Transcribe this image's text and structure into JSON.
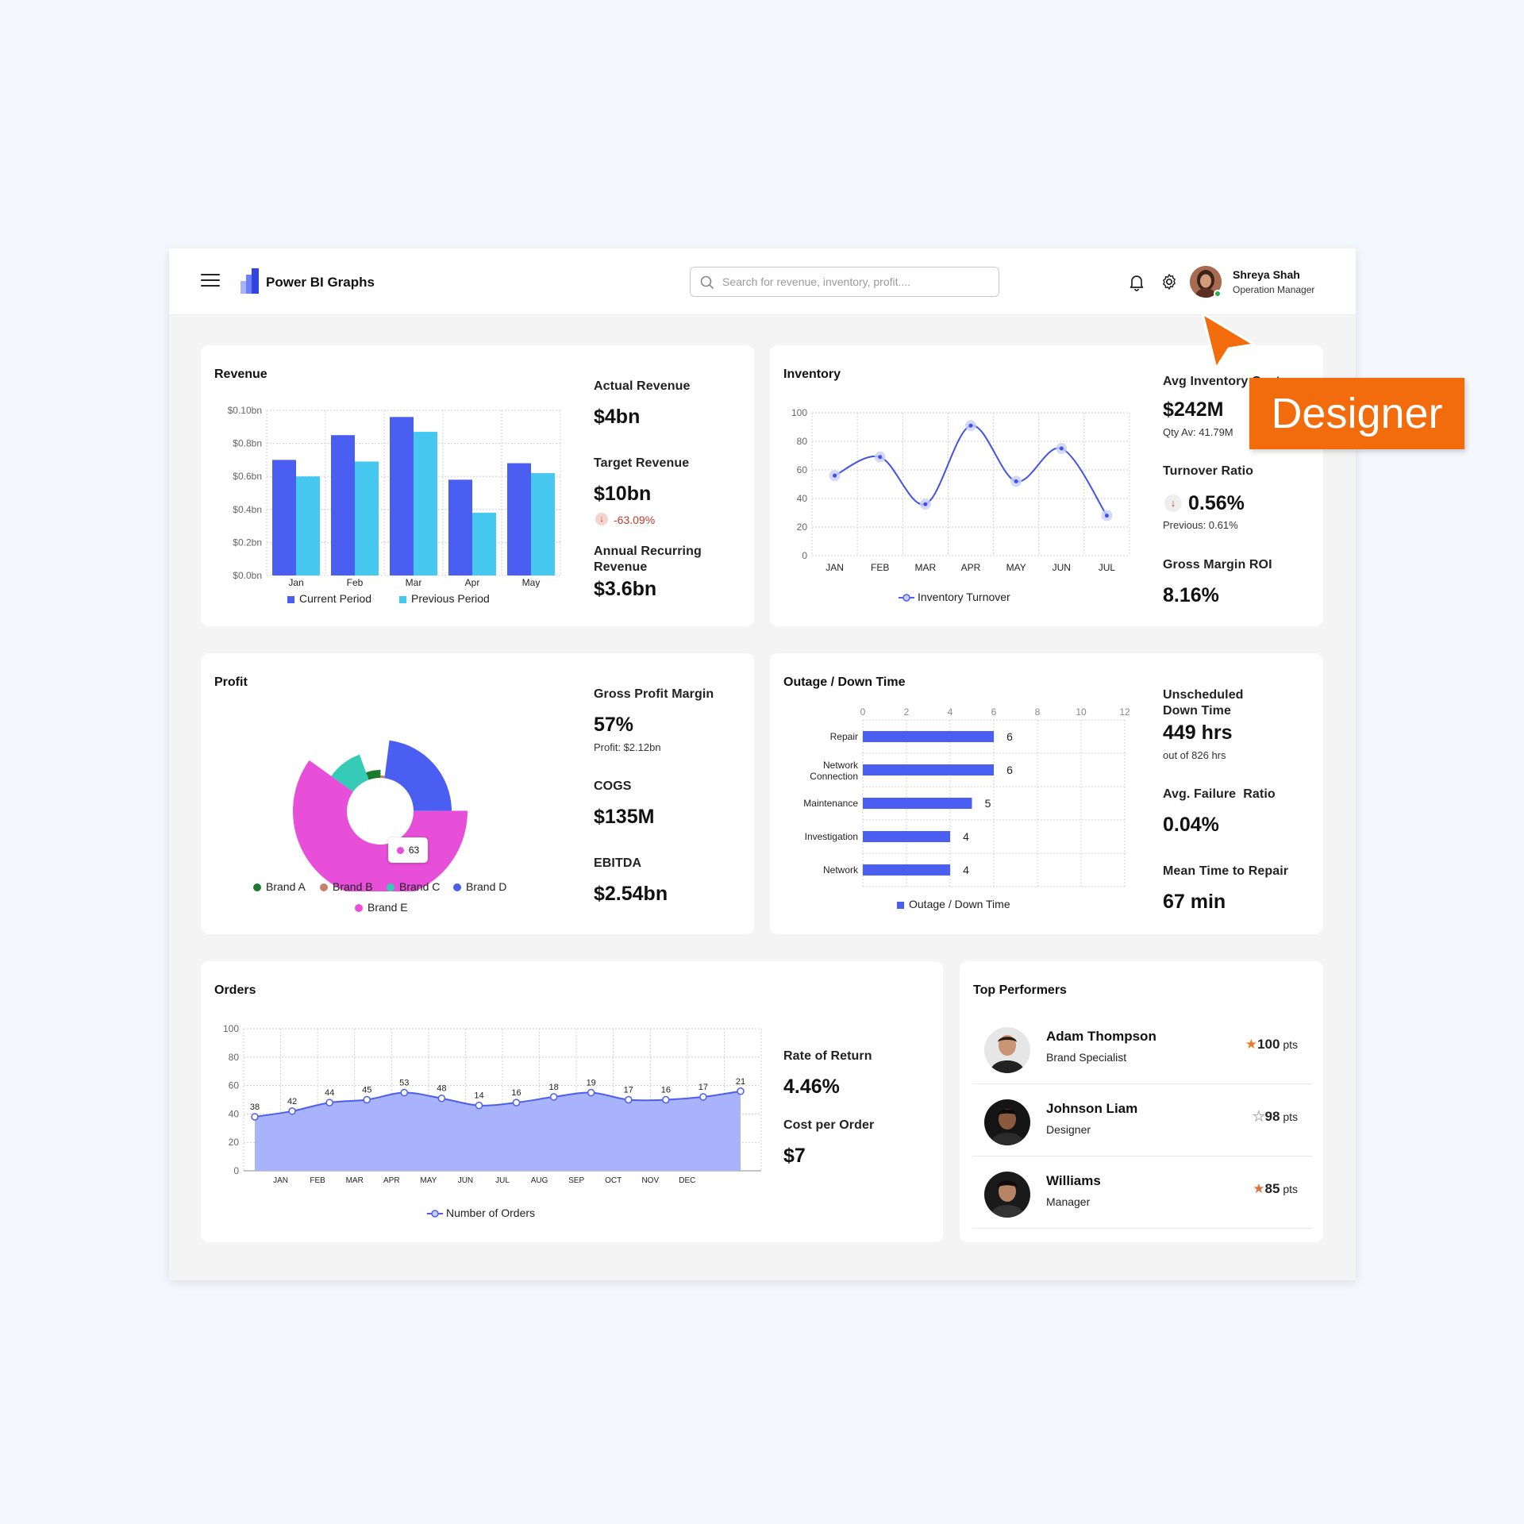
{
  "app": {
    "title": "Power BI Graphs"
  },
  "search": {
    "placeholder": "Search for revenue, inventory, profit...."
  },
  "user": {
    "name": "Shreya Shah",
    "role": "Operation Manager"
  },
  "overlay": {
    "tag": "Designer"
  },
  "colors": {
    "accent": "#4a5ef2",
    "light_blue": "#46c8f0",
    "orange": "#f26c0d",
    "negative": "#c0392b",
    "area_fill": "#a9b3fb"
  },
  "revenue": {
    "title": "Revenue",
    "actual_label": "Actual Revenue",
    "actual_value": "$4bn",
    "target_label": "Target Revenue",
    "target_value": "$10bn",
    "target_change": "-63.09%",
    "arr_label": "Annual  Recurring Revenue",
    "arr_value": "$3.6bn"
  },
  "inventory": {
    "title": "Inventory",
    "avg_cost_label": "Avg Inventory Cost",
    "avg_cost_value": "$242M",
    "qty_avg": "Qty Av: 41.79M",
    "turnover_label": "Turnover Ratio",
    "turnover_value": "0.56%",
    "turnover_prev": "Previous: 0.61%",
    "gmroi_label": "Gross Margin ROI",
    "gmroi_value": "8.16%"
  },
  "profit": {
    "title": "Profit",
    "gpm_label": "Gross Profit Margin",
    "gpm_value": "57%",
    "gpm_sub": "Profit: $2.12bn",
    "cogs_label": "COGS",
    "cogs_value": "$135M",
    "ebitda_label": "EBITDA",
    "ebitda_value": "$2.54bn"
  },
  "outage": {
    "title": "Outage / Down Time",
    "unsched_label": "Unscheduled Down Time",
    "unsched_value": "449 hrs",
    "unsched_sub": "out of 826 hrs",
    "afr_label": "Avg. Failure  Ratio",
    "afr_value": "0.04%",
    "mttr_label": "Mean Time to Repair",
    "mttr_value": "67 min"
  },
  "orders": {
    "title": "Orders",
    "ror_label": "Rate of Return",
    "ror_value": "4.46%",
    "cpo_label": "Cost per Order",
    "cpo_value": "$7"
  },
  "performers": {
    "title": "Top Performers",
    "items": [
      {
        "name": "Adam Thompson",
        "role": "Brand Specialist",
        "points": "100",
        "unit": "pts",
        "star": "#f07a2a"
      },
      {
        "name": "Johnson Liam",
        "role": "Designer",
        "points": "98",
        "unit": "pts",
        "star": "#ffffff"
      },
      {
        "name": "Williams",
        "role": "Manager",
        "points": "85",
        "unit": "pts",
        "star": "#e07040"
      }
    ]
  },
  "chart_data": [
    {
      "id": "revenue",
      "type": "bar",
      "categories": [
        "Jan",
        "Feb",
        "Mar",
        "Apr",
        "May"
      ],
      "y_ticks": [
        "$0.0bn",
        "$0.2bn",
        "$0.4bn",
        "$0.6bn",
        "$0.8bn",
        "$0.10bn"
      ],
      "ylim": [
        0,
        1.0
      ],
      "series": [
        {
          "name": "Current Period",
          "color": "#4a5ef2",
          "values": [
            0.7,
            0.85,
            0.96,
            0.58,
            0.68
          ]
        },
        {
          "name": "Previous Period",
          "color": "#46c8f0",
          "values": [
            0.6,
            0.69,
            0.87,
            0.38,
            0.62
          ]
        }
      ]
    },
    {
      "id": "inventory",
      "type": "line",
      "categories": [
        "JAN",
        "FEB",
        "MAR",
        "APR",
        "MAY",
        "JUN",
        "JUL"
      ],
      "ylim": [
        0,
        100
      ],
      "y_ticks": [
        0,
        20,
        40,
        60,
        80,
        100
      ],
      "series": [
        {
          "name": "Inventory Turnover",
          "color": "#3f51e8",
          "values": [
            56,
            69,
            36,
            91,
            52,
            75,
            28
          ]
        }
      ]
    },
    {
      "id": "profit",
      "type": "pie",
      "labels": [
        "Brand A",
        "Brand B",
        "Brand C",
        "Brand D",
        "Brand E"
      ],
      "colors": [
        "#1b7a2c",
        "#c8806a",
        "#36cbb6",
        "#4a5ef2",
        "#e84fd8"
      ],
      "values": [
        6,
        2,
        10,
        24,
        63
      ],
      "tooltip": {
        "label": "Brand E",
        "value": "63"
      }
    },
    {
      "id": "outage",
      "type": "bar",
      "orientation": "horizontal",
      "categories": [
        "Repair",
        "Network Connection",
        "Maintenance",
        "Investigation",
        "Network"
      ],
      "x_ticks": [
        0,
        2,
        4,
        6,
        8,
        10,
        12
      ],
      "xlim": [
        0,
        12
      ],
      "series": [
        {
          "name": "Outage / Down Time",
          "color": "#4a5ef2",
          "values": [
            6,
            6,
            5,
            4,
            4
          ]
        }
      ]
    },
    {
      "id": "orders",
      "type": "area",
      "categories": [
        "JAN",
        "FEB",
        "MAR",
        "APR",
        "MAY",
        "JUN",
        "JUL",
        "AUG",
        "SEP",
        "OCT",
        "NOV",
        "DEC"
      ],
      "ylim": [
        0,
        100
      ],
      "y_ticks": [
        0,
        20,
        40,
        60,
        80,
        100
      ],
      "series": [
        {
          "name": "Number of Orders",
          "color": "#4a5ef2",
          "values": [
            38,
            42,
            48,
            50,
            55,
            51,
            46,
            48,
            52,
            55,
            50,
            50,
            52,
            56
          ],
          "labels": [
            "38",
            "42",
            "44",
            "45",
            "53",
            "48",
            "14",
            "16",
            "18",
            "19",
            "17",
            "16",
            "17",
            "21"
          ]
        }
      ]
    }
  ]
}
